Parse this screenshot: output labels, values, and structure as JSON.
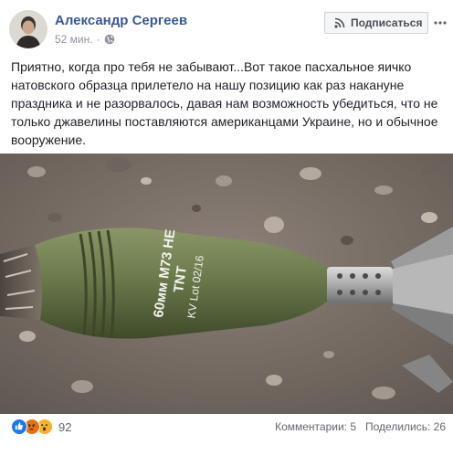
{
  "post": {
    "author_name": "Александр Сергеев",
    "time": "52 мин.",
    "dot": "·",
    "subscribe_label": "Подписаться",
    "text": "Приятно, когда про тебя не забывают...Вот такое пасхальное яичко натовского образца прилетело на нашу позицию как раз накануне праздника и не разорвалось, давая нам возможность убедиться, что не только джавелины поставляются американцами Украине, но и обычное вооружение."
  },
  "photo": {
    "marking_line1": "60мм M73 HE",
    "marking_line2": "TNT",
    "marking_line3": "KV Lot 02/16"
  },
  "footer": {
    "reaction_count": "92",
    "comments": "Комментарии: 5",
    "shares": "Поделились: 26"
  },
  "icons": {
    "avatar": "avatar",
    "globe": "globe-icon",
    "rss": "rss-icon",
    "more": "more-icon",
    "reactions": [
      "like-icon",
      "angry-icon",
      "wow-icon"
    ]
  },
  "colors": {
    "author": "#385898",
    "meta": "#90949c",
    "like": "#1877f2",
    "angry": "#e9710f",
    "wow": "#f7b125",
    "shell_green": "#6a7a4a"
  }
}
